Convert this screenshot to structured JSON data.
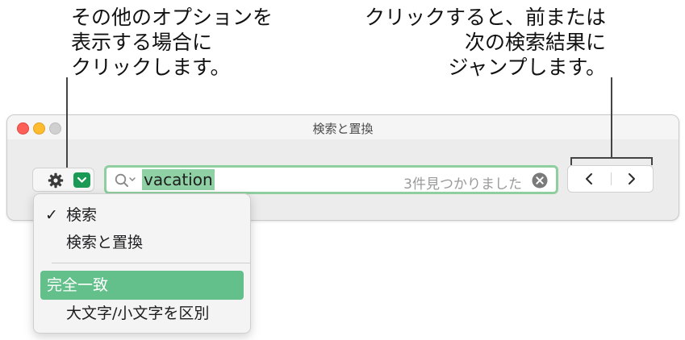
{
  "callouts": {
    "left": [
      "その他のオプションを",
      "表示する場合に",
      "クリックします。"
    ],
    "right": [
      "クリックすると、前または",
      "次の検索結果に",
      "ジャンプします。"
    ]
  },
  "window": {
    "title": "検索と置換"
  },
  "toolbar": {
    "gear_icon": "gear-icon",
    "menu_toggle_icon": "chevron-down-icon"
  },
  "search": {
    "value": "vacation",
    "result_count": "3件見つかりました",
    "clear_icon": "clear-icon"
  },
  "navigation": {
    "prev_icon": "chevron-left-icon",
    "next_icon": "chevron-right-icon"
  },
  "menu": {
    "items": [
      {
        "label": "検索",
        "checked": true
      },
      {
        "label": "検索と置換",
        "checked": false
      },
      {
        "label": "完全一致",
        "checked": false,
        "highlighted": true
      },
      {
        "label": "大文字/小文字を区別",
        "checked": false
      }
    ],
    "check_mark": "✓"
  },
  "colors": {
    "accent_green": "#1a9a55",
    "highlight_green": "#64c08a",
    "search_highlight": "#8fd1a4",
    "focus_ring": "#8fce9e"
  }
}
